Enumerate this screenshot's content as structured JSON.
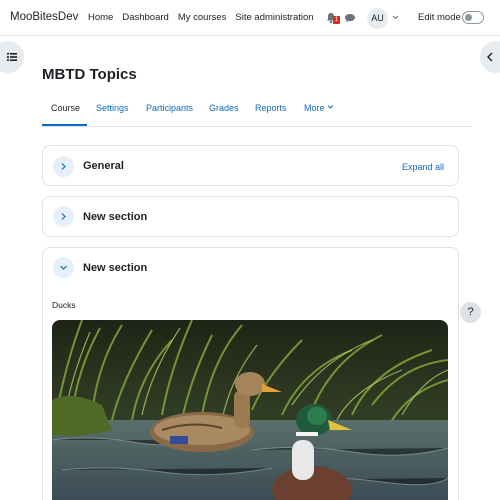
{
  "navbar": {
    "brand": "MooBitesDev",
    "links": [
      "Home",
      "Dashboard",
      "My courses",
      "Site administration"
    ],
    "notification_count": "1",
    "avatar_initials": "AU",
    "edit_mode_label": "Edit mode",
    "edit_mode_on": false
  },
  "course": {
    "title": "MBTD Topics",
    "tabs": [
      "Course",
      "Settings",
      "Participants",
      "Grades",
      "Reports",
      "More"
    ],
    "active_tab": "Course"
  },
  "sections": [
    {
      "title": "General",
      "expanded": false,
      "action": "Expand all"
    },
    {
      "title": "New section",
      "expanded": false
    },
    {
      "title": "New section",
      "expanded": true,
      "content_label": "Ducks"
    }
  ],
  "help_label": "?",
  "colors": {
    "link": "#0f6cbf",
    "accent_bg": "#e7f0fa",
    "badge": "#ca3120"
  }
}
